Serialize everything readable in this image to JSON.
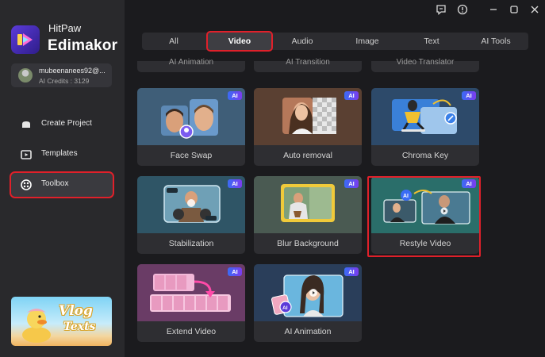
{
  "app": {
    "brand_line1": "HitPaw",
    "brand_line2": "Edimakor"
  },
  "account": {
    "name": "mubeenanees92@...",
    "credits": "AI Credits : 3129"
  },
  "nav": [
    {
      "label": "Create Project",
      "icon": "create-project-icon",
      "active": false
    },
    {
      "label": "Templates",
      "icon": "templates-icon",
      "active": false
    },
    {
      "label": "Toolbox",
      "icon": "toolbox-icon",
      "active": true
    }
  ],
  "promo": {
    "word1": "Vlog",
    "word2": "Texts"
  },
  "tabs": [
    {
      "label": "All",
      "active": false
    },
    {
      "label": "Video",
      "active": true
    },
    {
      "label": "Audio",
      "active": false
    },
    {
      "label": "Image",
      "active": false
    },
    {
      "label": "Text",
      "active": false
    },
    {
      "label": "AI Tools",
      "active": false
    }
  ],
  "partial_cards": [
    "AI Animation",
    "AI Transition",
    "Video Translator"
  ],
  "cards": [
    {
      "title": "Face Swap",
      "ai": "AI"
    },
    {
      "title": "Auto removal",
      "ai": "AI"
    },
    {
      "title": "Chroma Key",
      "ai": "AI"
    },
    {
      "title": "Stabilization",
      "ai": "AI"
    },
    {
      "title": "Blur Background",
      "ai": "AI"
    },
    {
      "title": "Restyle Video",
      "ai": "AI"
    },
    {
      "title": "Extend Video",
      "ai": "AI"
    },
    {
      "title": "AI Animation",
      "ai": "AI"
    }
  ],
  "colors": {
    "accent": "#e0202a",
    "badge_start": "#3a6cf5",
    "badge_end": "#7b3cf0"
  },
  "titlebar_icons": [
    "feedback-icon",
    "update-icon",
    "minimize-icon",
    "maximize-icon",
    "close-icon"
  ]
}
